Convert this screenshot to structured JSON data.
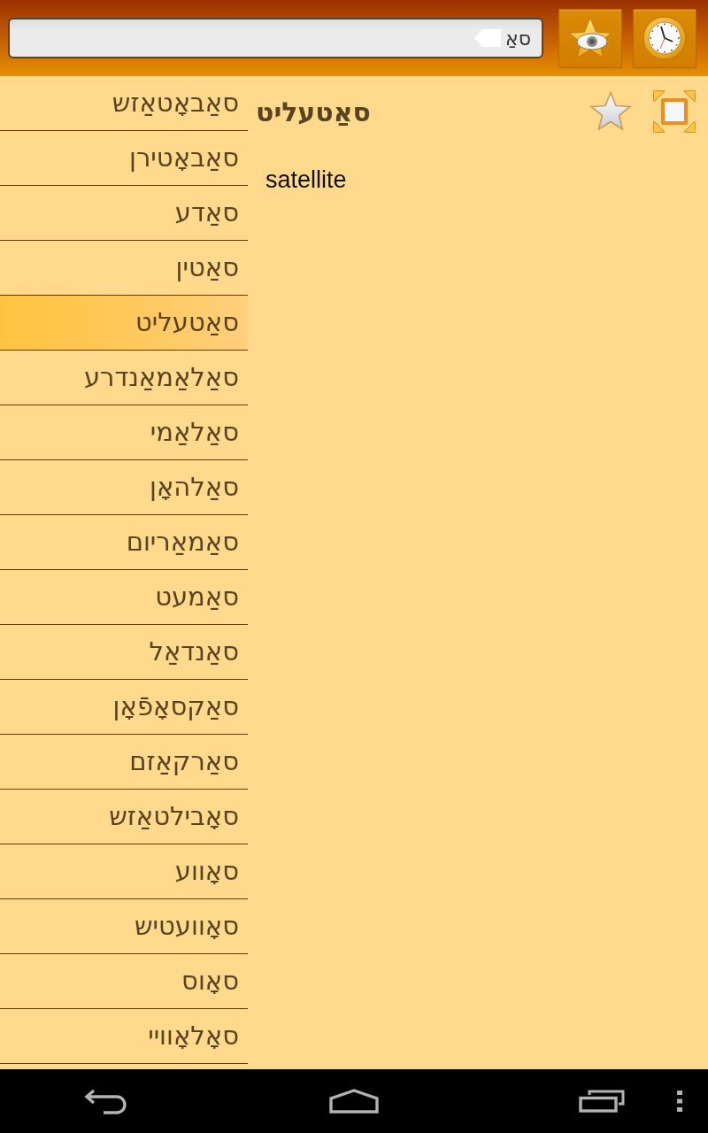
{
  "search": {
    "value": "סאַ"
  },
  "word_list": [
    {
      "word": "סאַבאָטאַזש",
      "selected": false
    },
    {
      "word": "סאַבאָטירן",
      "selected": false
    },
    {
      "word": "סאַדע",
      "selected": false
    },
    {
      "word": "סאַטין",
      "selected": false
    },
    {
      "word": "סאַטעליט",
      "selected": true
    },
    {
      "word": "סאַלאַמאַנדרע",
      "selected": false
    },
    {
      "word": "סאַלאַמי",
      "selected": false
    },
    {
      "word": "סאַלהאָן",
      "selected": false
    },
    {
      "word": "סאַמאַריום",
      "selected": false
    },
    {
      "word": "סאַמעט",
      "selected": false
    },
    {
      "word": "סאַנדאַל",
      "selected": false
    },
    {
      "word": "סאַקסאָפֿאָן",
      "selected": false
    },
    {
      "word": "סאַרקאַזם",
      "selected": false
    },
    {
      "word": "סאָבילטאַזש",
      "selected": false
    },
    {
      "word": "סאָווע",
      "selected": false
    },
    {
      "word": "סאָוועטיש",
      "selected": false
    },
    {
      "word": "סאָוס",
      "selected": false
    },
    {
      "word": "סאָלאָוויי",
      "selected": false
    }
  ],
  "entry": {
    "headword": "סאַטעליט",
    "translation": "satellite"
  }
}
